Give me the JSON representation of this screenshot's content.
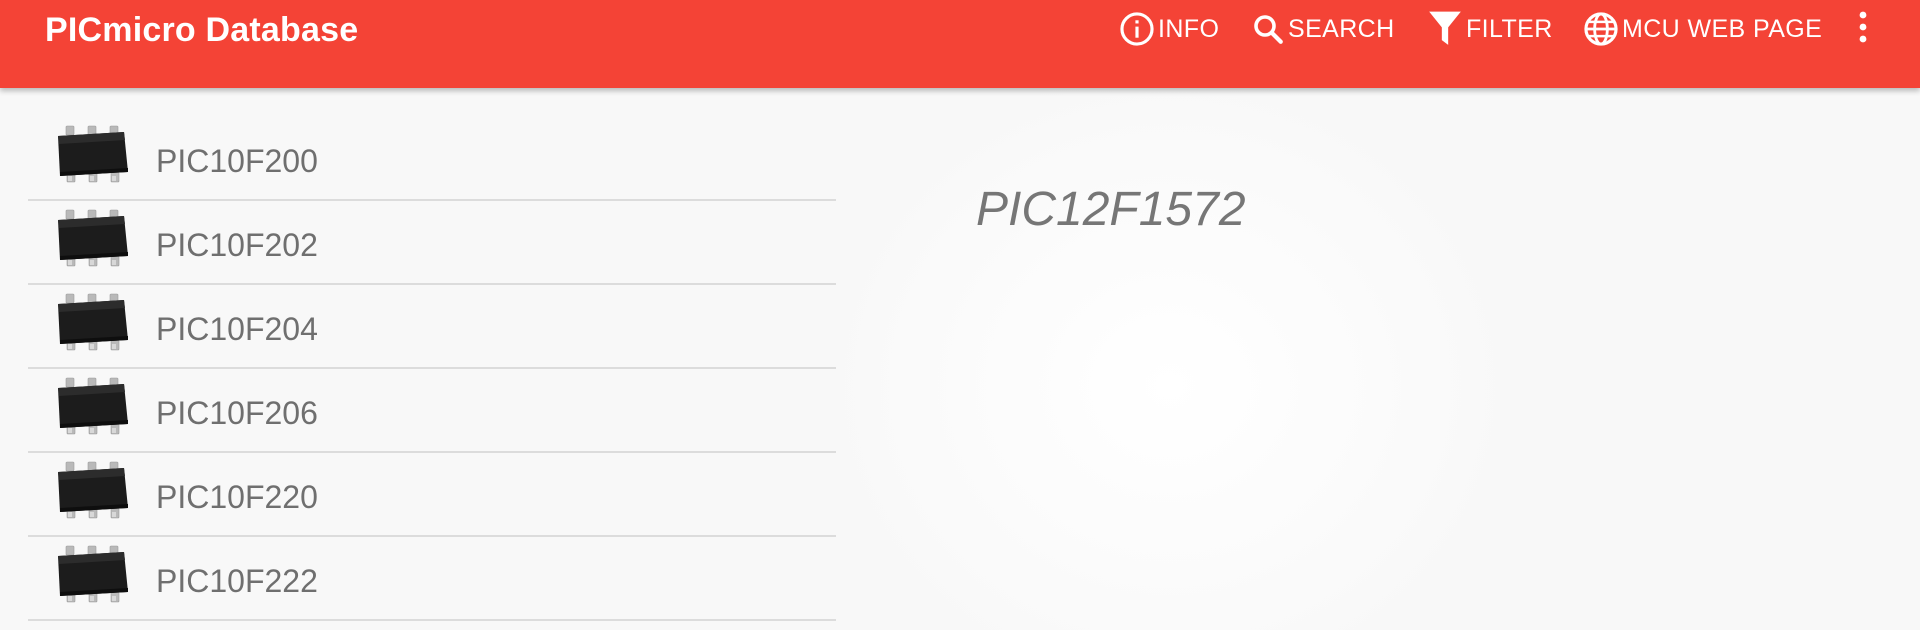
{
  "app": {
    "title": "PICmicro Database",
    "accent_color": "#f44336"
  },
  "toolbar": {
    "actions": [
      {
        "label": "INFO",
        "icon": "info-icon"
      },
      {
        "label": "SEARCH",
        "icon": "search-icon"
      },
      {
        "label": "FILTER",
        "icon": "filter-icon"
      },
      {
        "label": "MCU WEB PAGE",
        "icon": "globe-icon"
      }
    ],
    "overflow_icon": "more-vert-icon"
  },
  "list": {
    "items": [
      {
        "label": "PIC10F200",
        "icon": "chip-icon"
      },
      {
        "label": "PIC10F202",
        "icon": "chip-icon"
      },
      {
        "label": "PIC10F204",
        "icon": "chip-icon"
      },
      {
        "label": "PIC10F206",
        "icon": "chip-icon"
      },
      {
        "label": "PIC10F220",
        "icon": "chip-icon"
      },
      {
        "label": "PIC10F222",
        "icon": "chip-icon"
      }
    ]
  },
  "detail": {
    "title": "PIC12F1572"
  }
}
